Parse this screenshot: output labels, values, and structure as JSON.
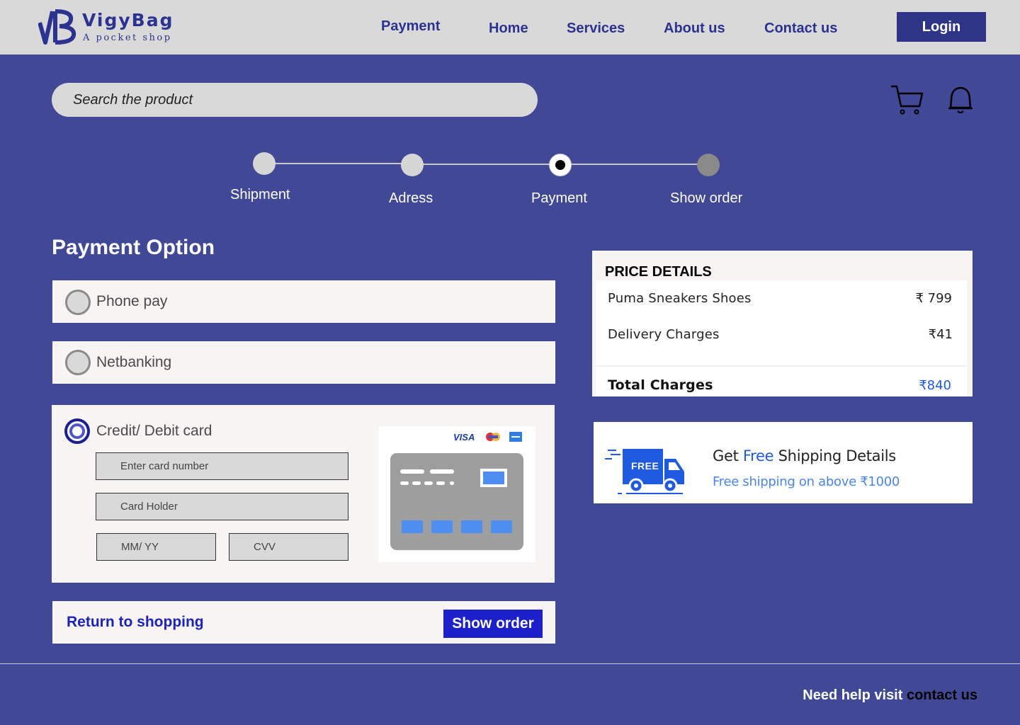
{
  "brand": {
    "name": "VigyBag",
    "tagline": "A pocket shop",
    "color": "#2b3390"
  },
  "nav": [
    {
      "label": "Payment"
    },
    {
      "label": "Home"
    },
    {
      "label": "Services"
    },
    {
      "label": "About us"
    },
    {
      "label": "Contact us"
    }
  ],
  "login_label": "Login",
  "search": {
    "placeholder": "Search the product"
  },
  "icons": {
    "cart": "cart-icon",
    "bell": "bell-icon"
  },
  "steps": [
    {
      "label": "Shipment",
      "state": "done"
    },
    {
      "label": "Adress",
      "state": "done"
    },
    {
      "label": "Payment",
      "state": "active"
    },
    {
      "label": "Show order",
      "state": "pending"
    }
  ],
  "payment": {
    "title": "Payment Option",
    "options": [
      {
        "label": "Phone pay",
        "selected": false
      },
      {
        "label": "Netbanking",
        "selected": false
      },
      {
        "label": "Credit/ Debit card",
        "selected": true
      }
    ],
    "card_fields": {
      "number_placeholder": "Enter card number",
      "holder_placeholder": "Card Holder",
      "expiry_placeholder": "MM/ YY",
      "cvv_placeholder": "CVV"
    },
    "card_brands": [
      "VISA",
      "mastercard",
      "amex"
    ]
  },
  "actions": {
    "return_label": "Return to shopping",
    "show_order_label": "Show order"
  },
  "price_details": {
    "title": "PRICE DETAILS",
    "rows": [
      {
        "label": "Puma Sneakers Shoes",
        "value": "₹ 799"
      },
      {
        "label": "Delivery Charges",
        "value": "₹41"
      }
    ],
    "total_label": "Total Charges",
    "total_value": "₹840",
    "total_color": "#1e5be0"
  },
  "shipping": {
    "badge": "FREE",
    "title_prefix": "Get ",
    "title_highlight": "Free",
    "title_suffix": " Shipping Details",
    "subtitle": "Free shipping on above ₹1000"
  },
  "footer": {
    "help_text": "Need help visit ",
    "link_text": "contact us"
  },
  "colors": {
    "background": "#414895",
    "accent": "#1c20c9"
  }
}
